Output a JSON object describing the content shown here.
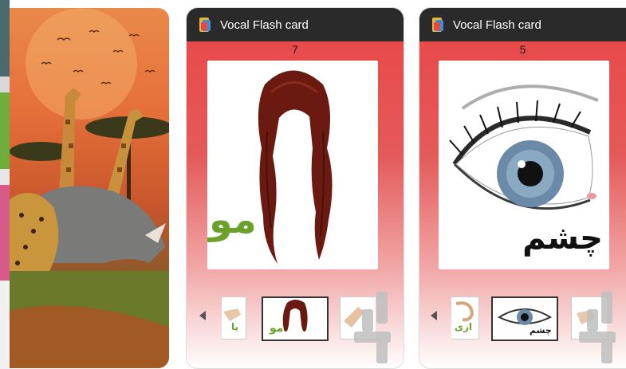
{
  "strip_colors": [
    "#4a6a6e",
    "#d9d9d9",
    "#6fae3c",
    "#e6e6e6",
    "#d85a8a",
    "#f0f0f0"
  ],
  "phones": [
    {
      "title": "Vocal Flash card",
      "counter": "7",
      "word": "مو",
      "word_color": "#6aa12a",
      "thumbs": [
        "hand-card-thumbnail",
        "hair-card-thumbnail",
        "finger-card-thumbnail"
      ],
      "thumb_labels": [
        "پا",
        "مو",
        ""
      ],
      "selected_thumb": 1
    },
    {
      "title": "Vocal Flash card",
      "counter": "5",
      "word": "چشم",
      "word_color": "#111111",
      "thumbs": [
        "ear-card-thumbnail",
        "eye-card-thumbnail",
        "hand-card-thumbnail"
      ],
      "thumb_labels": [
        "ازی",
        "چشم",
        ""
      ],
      "selected_thumb": 1
    }
  ]
}
